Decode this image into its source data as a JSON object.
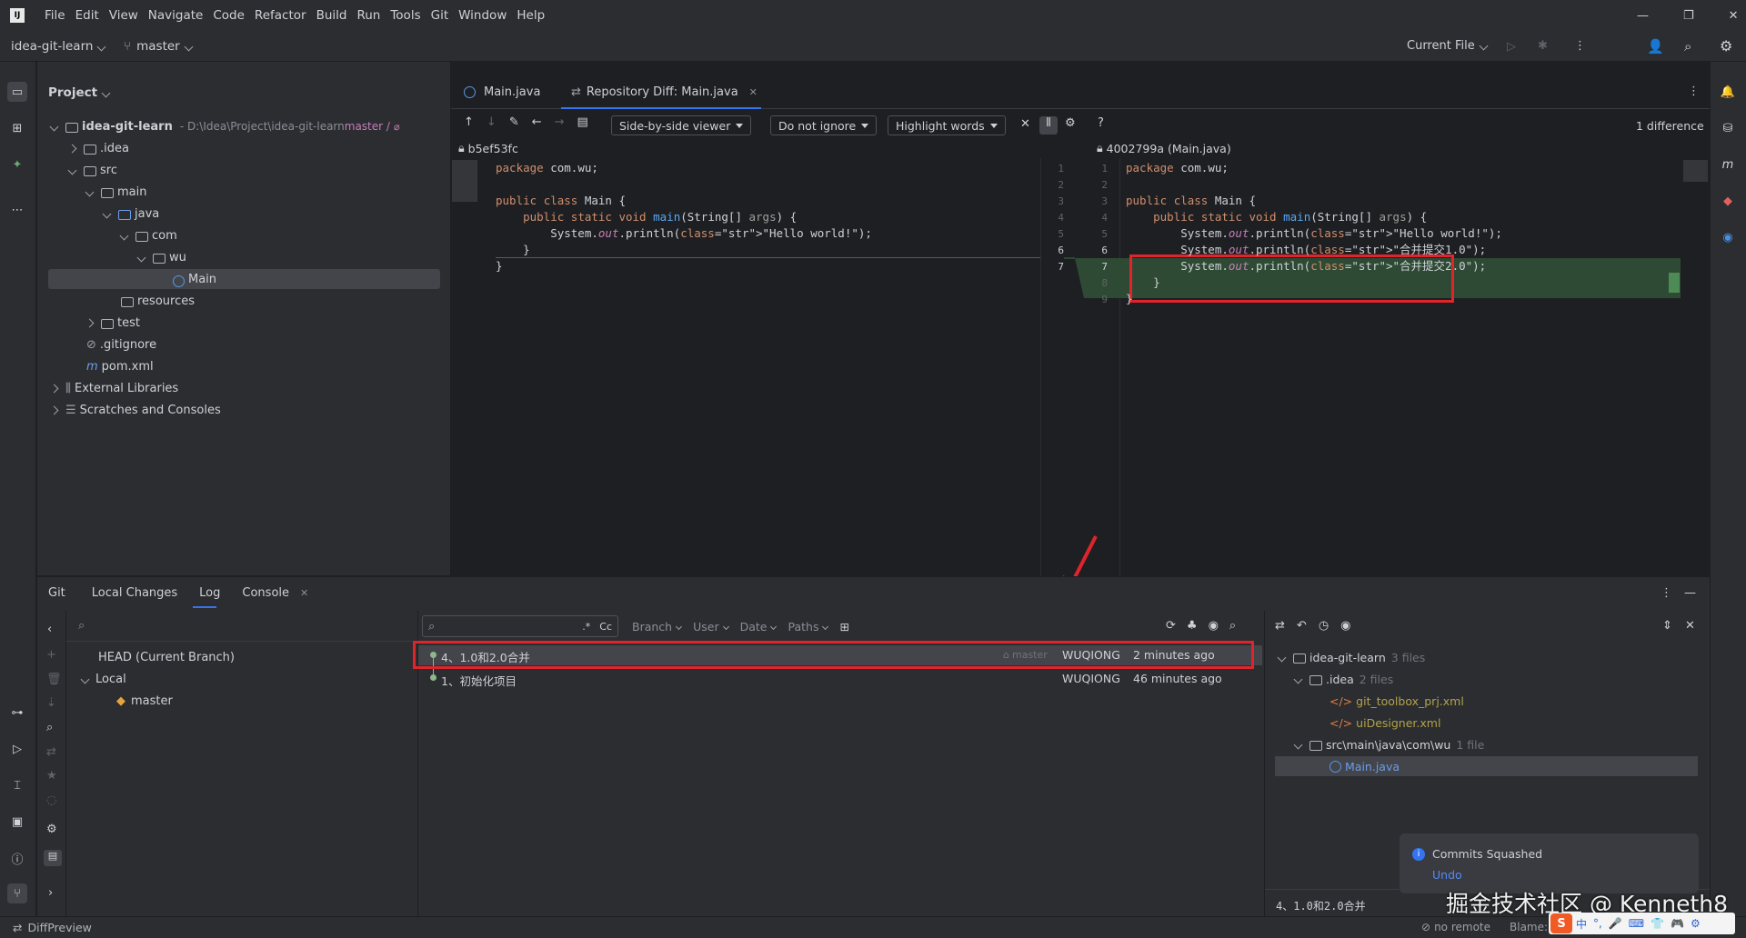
{
  "menu": [
    "File",
    "Edit",
    "View",
    "Navigate",
    "Code",
    "Refactor",
    "Build",
    "Run",
    "Tools",
    "Git",
    "Window",
    "Help"
  ],
  "toolbar": {
    "project": "idea-git-learn",
    "branch": "master",
    "run_config": "Current File"
  },
  "project_panel": {
    "title": "Project",
    "root": {
      "name": "idea-git-learn",
      "path": "- D:\\Idea\\Project\\idea-git-learn",
      "branch": "master /"
    },
    "items": [
      ".idea",
      "src",
      "main",
      "java",
      "com",
      "wu",
      "Main",
      "resources",
      "test",
      ".gitignore",
      "pom.xml",
      "External Libraries",
      "Scratches and Consoles"
    ]
  },
  "tabs": [
    {
      "label": "Main.java"
    },
    {
      "label": "Repository Diff: Main.java"
    }
  ],
  "diff": {
    "viewer": "Side-by-side viewer",
    "ignore": "Do not ignore",
    "highlight": "Highlight words",
    "differences": "1 difference",
    "left_rev": "b5ef53fc",
    "right_rev": "4002799a (Main.java)",
    "left_lines": [
      "package com.wu;",
      "",
      "public class Main {",
      "    public static void main(String[] args) {",
      "        System.out.println(\"Hello world!\");",
      "    }",
      "}"
    ],
    "right_lines": [
      "package com.wu;",
      "",
      "public class Main {",
      "    public static void main(String[] args) {",
      "        System.out.println(\"Hello world!\");",
      "        System.out.println(\"合并提交1.0\");",
      "        System.out.println(\"合并提交2.0\");",
      "    }",
      "}"
    ],
    "gutter_left": [
      "1",
      "2",
      "3",
      "4",
      "5",
      "6",
      "7"
    ],
    "gutter_right": [
      "1",
      "2",
      "3",
      "4",
      "5",
      "6",
      "7",
      "8",
      "9"
    ]
  },
  "git_tabs": [
    {
      "label": "Git"
    },
    {
      "label": "Local Changes"
    },
    {
      "label": "Log"
    },
    {
      "label": "Console"
    }
  ],
  "branches": {
    "head": "HEAD (Current Branch)",
    "local": "Local",
    "master": "master"
  },
  "log_filters": {
    "branch": "Branch",
    "user": "User",
    "date": "Date",
    "paths": "Paths",
    "regex": ".*",
    "case": "Cc"
  },
  "commits": [
    {
      "message": "4、1.0和2.0合并",
      "tag": "master",
      "author": "WUQIONG",
      "time": "2 minutes ago"
    },
    {
      "message": "1、初始化项目",
      "author": "WUQIONG",
      "time": "46 minutes ago"
    }
  ],
  "changes_tree": {
    "root": "idea-git-learn",
    "root_count": "3 files",
    "idea": ".idea",
    "idea_count": "2 files",
    "file1": "git_toolbox_prj.xml",
    "file2": "uiDesigner.xml",
    "pkg": "src\\main\\java\\com\\wu",
    "pkg_count": "1 file",
    "file3": "Main.java"
  },
  "commit_detail": "4、1.0和2.0合并",
  "notification": {
    "title": "Commits Squashed",
    "action": "Undo"
  },
  "watermark": "掘金技术社区 @ Kenneth8",
  "status": {
    "left": "DiffPreview",
    "remote": "no remote",
    "blame": "Blame:"
  },
  "ime": [
    "中",
    "°,",
    "🎤",
    "⌨",
    "👕",
    "🎮",
    "⚙"
  ]
}
